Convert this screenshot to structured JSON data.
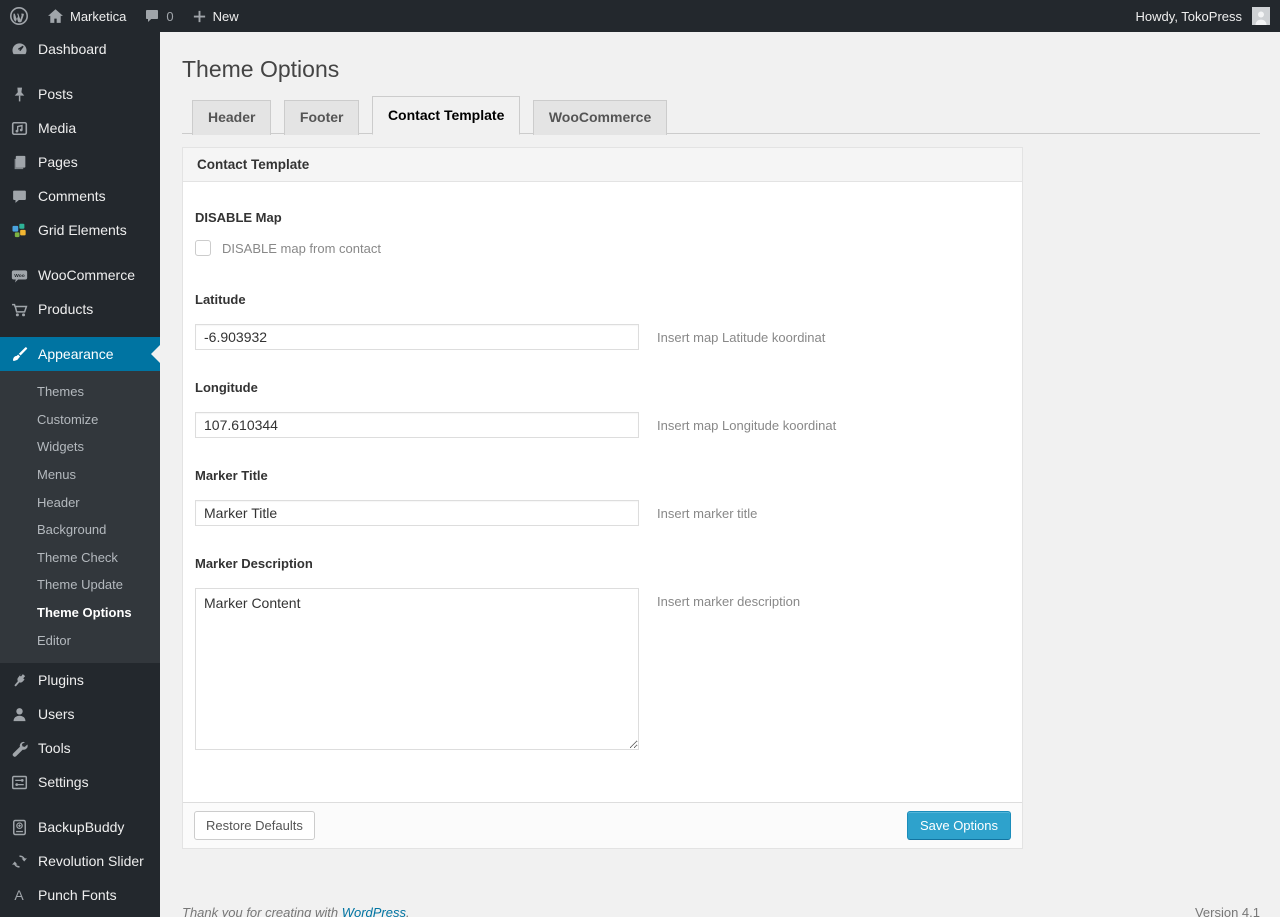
{
  "admin_bar": {
    "site_name": "Marketica",
    "comment_count": "0",
    "new_label": "New",
    "howdy": "Howdy, TokoPress"
  },
  "sidebar": {
    "items": [
      {
        "label": "Dashboard"
      },
      {
        "label": "Posts"
      },
      {
        "label": "Media"
      },
      {
        "label": "Pages"
      },
      {
        "label": "Comments"
      },
      {
        "label": "Grid Elements"
      },
      {
        "label": "WooCommerce"
      },
      {
        "label": "Products"
      },
      {
        "label": "Appearance"
      },
      {
        "label": "Plugins"
      },
      {
        "label": "Users"
      },
      {
        "label": "Tools"
      },
      {
        "label": "Settings"
      },
      {
        "label": "BackupBuddy"
      },
      {
        "label": "Revolution Slider"
      },
      {
        "label": "Punch Fonts"
      }
    ],
    "active_item": "Appearance",
    "appearance_submenu": [
      "Themes",
      "Customize",
      "Widgets",
      "Menus",
      "Header",
      "Background",
      "Theme Check",
      "Theme Update",
      "Theme Options",
      "Editor"
    ],
    "active_submenu_item": "Theme Options"
  },
  "page": {
    "title": "Theme Options",
    "tabs": [
      {
        "label": "Header",
        "active": false
      },
      {
        "label": "Footer",
        "active": false
      },
      {
        "label": "Contact Template",
        "active": true
      },
      {
        "label": "WooCommerce",
        "active": false
      }
    ],
    "panel": {
      "header": "Contact Template",
      "disable_map": {
        "label": "DISABLE Map",
        "checkbox_label": "DISABLE map from contact",
        "checked": false
      },
      "latitude": {
        "label": "Latitude",
        "value": "-6.903932",
        "hint": "Insert map Latitude koordinat"
      },
      "longitude": {
        "label": "Longitude",
        "value": "107.610344",
        "hint": "Insert map Longitude koordinat"
      },
      "marker_title": {
        "label": "Marker Title",
        "value": "Marker Title",
        "hint": "Insert marker title"
      },
      "marker_description": {
        "label": "Marker Description",
        "value": "Marker Content",
        "hint": "Insert marker description"
      },
      "restore_button": "Restore Defaults",
      "save_button": "Save Options"
    }
  },
  "page_footer": {
    "thanks_prefix": "Thank you for creating with ",
    "link_label": "WordPress",
    "suffix": ".",
    "version": "Version 4.1"
  },
  "colors": {
    "accent": "#0074a2",
    "primary_button": "#2ea2cc",
    "admin_bar_bg": "#23282d",
    "submenu_bg": "#32373c",
    "page_bg": "#f1f1f1"
  }
}
